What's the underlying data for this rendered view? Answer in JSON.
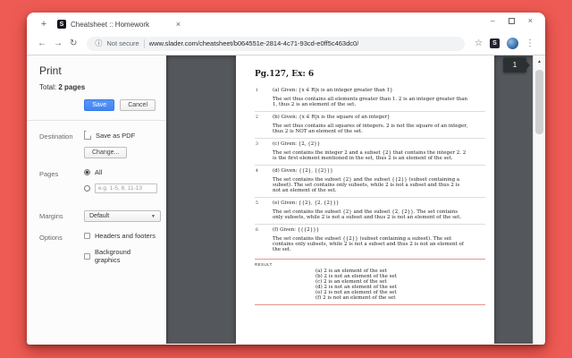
{
  "colors": {
    "desktop_background": "#ee5b54",
    "preview_background": "#54585c",
    "accent_blue": "#4285f4",
    "result_rule_pink": "#e8968e"
  },
  "window": {
    "new_tab_button": "+",
    "tab": {
      "favicon_letter": "S",
      "title": "Cheatsheet :: Homework",
      "close_icon": "×"
    },
    "controls": {
      "minimize": "–",
      "close": "×"
    },
    "toolbar": {
      "back_icon": "←",
      "forward_icon": "→",
      "reload_icon": "↻",
      "info_icon": "ⓘ",
      "security_text": "Not secure",
      "url": "www.slader.com/cheatsheet/b064551e-2814-4c71-93cd-e0ff5c463dc0/",
      "star_icon": "☆",
      "extension_letter": "S",
      "menu_icon": "⋮"
    }
  },
  "print_dialog": {
    "title": "Print",
    "total_label": "Total:",
    "total_value": "2 pages",
    "save_button": "Save",
    "cancel_button": "Cancel",
    "destination": {
      "label": "Destination",
      "value": "Save as PDF",
      "change_button": "Change..."
    },
    "pages": {
      "label": "Pages",
      "all_option": "All",
      "custom_placeholder": "e.g. 1-5, 8, 11-13"
    },
    "margins": {
      "label": "Margins",
      "value": "Default",
      "arrow_icon": "▼"
    },
    "options": {
      "label": "Options",
      "headers_label": "Headers and footers",
      "background_label": "Background graphics"
    }
  },
  "preview": {
    "page_indicator": "1",
    "scroll_up_icon": "▲"
  },
  "document": {
    "title": "Pg.127, Ex: 6",
    "items": [
      {
        "num": "1",
        "given": "(a) Given: {x ∈ R|x is an integer greater than 1}",
        "body": "The set thus contains all elements greater than 1.  2 is an integer greater than 1, thus 2 is an element of the set."
      },
      {
        "num": "2",
        "given": "(b) Given: {x ∈ R|x is the square of an integer}",
        "body": "The set thus contains all squares of integers. 2 is not the square of an integer, thus 2 is NOT an element of the set."
      },
      {
        "num": "3",
        "given": "(c) Given: {2, {2}}",
        "body": "The set contains the integer 2 and a subset {2} that contains the integer 2. 2 is the first element mentioned in the set, thus 2 is an element of the set."
      },
      {
        "num": "4",
        "given": "(d) Given: {{2}, {{2}}}",
        "body": "The set contains the subset {2} and the subset {{2}} (subset containing a subset). The set contains only subsets, while 2 is not a subset and thus 2 is not an element of the set."
      },
      {
        "num": "5",
        "given": "(e) Given: {{2}, {2, {2}}}",
        "body": "The set contains the subset {2} and the subset {2, {2}}. The set contains only subsets, while 2 is not a subset and thus 2 is not an element of the set."
      },
      {
        "num": "6",
        "given": "(f) Given: {{{2}}}",
        "body": "The set contains the subset {{2}} (subset containing a subset). The set contains only subsets, while 2 is not a subset and thus 2 is not an element of the set."
      }
    ],
    "result_label": "RESULT",
    "results": [
      "(a) 2 is an element of the set",
      "(b) 2 is not an element of the set",
      "(c) 2 is an element of the set",
      "(d) 2 is not an element of the set",
      "(e) 2 is not an element of the set",
      "(f) 2 is not an element of the set"
    ]
  }
}
